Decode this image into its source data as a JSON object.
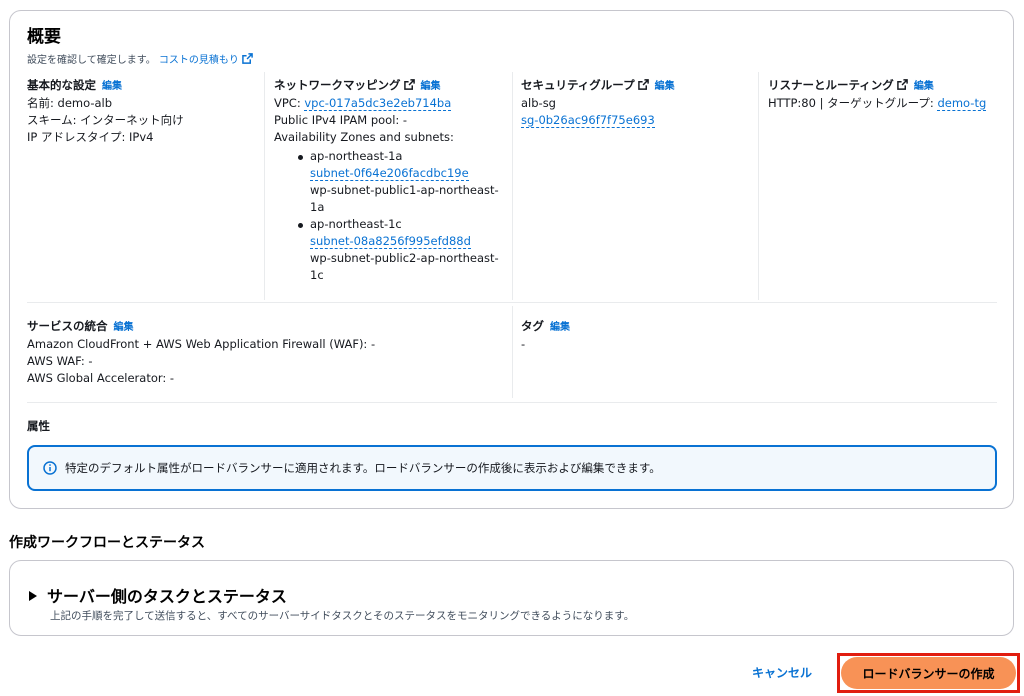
{
  "overview": {
    "title": "概要",
    "description": "設定を確認して確定します。",
    "cost_link": "コストの見積もり",
    "edit_label": "編集",
    "basic": {
      "heading": "基本的な設定",
      "name": "名前: demo-alb",
      "scheme": "スキーム: インターネット向け",
      "ip_type": "IP アドレスタイプ: IPv4"
    },
    "network": {
      "heading": "ネットワークマッピング",
      "vpc_label": "VPC: ",
      "vpc_link": "vpc-017a5dc3e2eb714ba",
      "ipam": "Public IPv4 IPAM pool: -",
      "az_label": "Availability Zones and subnets:",
      "azs": [
        {
          "zone": "ap-northeast-1a",
          "subnet": "subnet-0f64e206facdbc19e",
          "subnet_name_1": "wp-subnet-public1-ap-northeast-",
          "subnet_name_2": "1a"
        },
        {
          "zone": "ap-northeast-1c",
          "subnet": "subnet-08a8256f995efd88d",
          "subnet_name_1": "wp-subnet-public2-ap-northeast-",
          "subnet_name_2": "1c"
        }
      ]
    },
    "security": {
      "heading": "セキュリティグループ",
      "sg_name": "alb-sg",
      "sg_link": "sg-0b26ac96f7f75e693"
    },
    "listener": {
      "heading": "リスナーとルーティング",
      "text": "HTTP:80 | ターゲットグループ: ",
      "tg_link": "demo-tg"
    },
    "integration": {
      "heading": "サービスの統合",
      "line1": "Amazon CloudFront + AWS Web Application Firewall (WAF): -",
      "line2": "AWS WAF: -",
      "line3": "AWS Global Accelerator: -"
    },
    "tags": {
      "heading": "タグ",
      "value": "-"
    },
    "attributes": {
      "heading": "属性",
      "info": "特定のデフォルト属性がロードバランサーに適用されます。ロードバランサーの作成後に表示および編集できます。"
    }
  },
  "workflow": {
    "title": "作成ワークフローとステータス",
    "server_title": "サーバー側のタスクとステータス",
    "server_desc": "上記の手順を完了して送信すると、すべてのサーバーサイドタスクとそのステータスをモニタリングできるようになります。"
  },
  "actions": {
    "cancel": "キャンセル",
    "create": "ロードバランサーの作成"
  },
  "colors": {
    "link": "#0972d3",
    "primary_button": "#f89256",
    "highlight_border": "#e11d0f"
  }
}
